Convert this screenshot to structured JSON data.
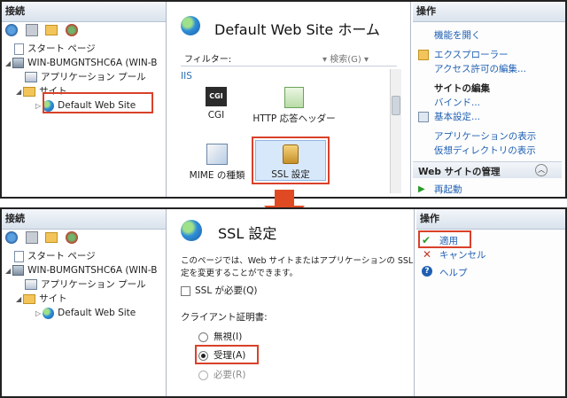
{
  "top": {
    "connections": {
      "header": "接続",
      "tree": [
        {
          "label": "スタート ページ",
          "icon": "start-page-icon"
        },
        {
          "label": "WIN-BUMGNTSHC6A (WIN-B",
          "icon": "server-icon"
        },
        {
          "label": "アプリケーション プール",
          "icon": "app-pool-icon"
        },
        {
          "label": "サイト",
          "icon": "sites-folder-icon"
        },
        {
          "label": "Default Web Site",
          "icon": "globe-icon"
        }
      ]
    },
    "center": {
      "title": "Default Web Site ホーム",
      "filter_label": "フィルター:",
      "search_label": "検索(G)",
      "section": "IIS",
      "features": [
        {
          "label": "CGI",
          "icon": "cgi-icon"
        },
        {
          "label": "HTTP 応答ヘッダー",
          "icon": "http-headers-icon"
        },
        {
          "label": "MIME の種類",
          "icon": "mime-types-icon"
        },
        {
          "label": "SSL 設定",
          "icon": "ssl-lock-icon"
        }
      ]
    },
    "actions": {
      "header": "操作",
      "items": [
        {
          "label": "機能を開く",
          "type": "link"
        },
        {
          "label": "エクスプローラー",
          "type": "link"
        },
        {
          "label": "アクセス許可の編集...",
          "type": "link"
        },
        {
          "label": "サイトの編集",
          "type": "heading"
        },
        {
          "label": "バインド...",
          "type": "link"
        },
        {
          "label": "基本設定...",
          "type": "link"
        },
        {
          "label": "アプリケーションの表示",
          "type": "link"
        },
        {
          "label": "仮想ディレクトリの表示",
          "type": "link"
        },
        {
          "label": "Web サイトの管理",
          "type": "heading"
        },
        {
          "label": "再起動",
          "type": "link"
        }
      ]
    }
  },
  "bottom": {
    "connections": {
      "header": "接続",
      "tree": [
        {
          "label": "スタート ページ"
        },
        {
          "label": "WIN-BUMGNTSHC6A (WIN-B"
        },
        {
          "label": "アプリケーション プール"
        },
        {
          "label": "サイト"
        },
        {
          "label": "Default Web Site"
        }
      ]
    },
    "center": {
      "title": "SSL 設定",
      "description_line1": "このページでは、Web サイトまたはアプリケーションの SSL 設",
      "description_line2": "定を変更することができます。",
      "require_ssl": {
        "label": "SSL が必要(Q)",
        "checked": false
      },
      "client_cert_label": "クライアント証明書:",
      "options": [
        {
          "label": "無視(I)",
          "selected": false,
          "disabled": false
        },
        {
          "label": "受理(A)",
          "selected": true,
          "disabled": false
        },
        {
          "label": "必要(R)",
          "selected": false,
          "disabled": true
        }
      ]
    },
    "actions": {
      "header": "操作",
      "items": [
        {
          "label": "適用",
          "icon": "apply-icon"
        },
        {
          "label": "キャンセル",
          "icon": "cancel-icon"
        },
        {
          "label": "ヘルプ",
          "icon": "help-icon"
        }
      ]
    }
  },
  "colors": {
    "highlight": "#d9412a",
    "link": "#1f5fb3",
    "arrow": "#e04a22"
  }
}
